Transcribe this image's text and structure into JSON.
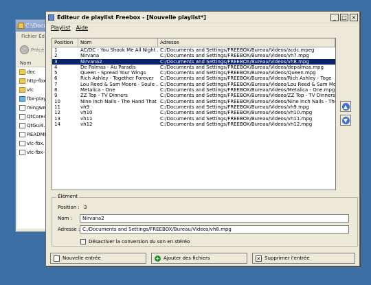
{
  "explorer": {
    "title": "C:\\Docu",
    "menu_file": "Fichier",
    "menu_edit": "Éd",
    "back_label": "Précé",
    "col_name": "Nom",
    "items": [
      {
        "name": "doc",
        "kind": "folder"
      },
      {
        "name": "http-fbx",
        "kind": "folder"
      },
      {
        "name": "vlc",
        "kind": "folder"
      },
      {
        "name": "fbx-play",
        "kind": "exe"
      },
      {
        "name": "mingwm",
        "kind": "file"
      },
      {
        "name": "QtCore4",
        "kind": "file"
      },
      {
        "name": "QtGui4.",
        "kind": "file"
      },
      {
        "name": "README",
        "kind": "file"
      },
      {
        "name": "vlc-fbx.",
        "kind": "file"
      },
      {
        "name": "vlc-fbx-",
        "kind": "file"
      }
    ]
  },
  "dialog": {
    "title": "Éditeur de playlist Freebox - [Nouvelle playlist*]",
    "menu": [
      "Playlist",
      "Aide"
    ],
    "columns": [
      "Position",
      "Nom",
      "Adresse"
    ],
    "rows": [
      {
        "pos": "1",
        "name": "AC/DC - You Shook Me All Night ...",
        "addr": "C:/Documents and Settings/FREEBOX/Bureau/Videos/acdc.mpeg"
      },
      {
        "pos": "2",
        "name": "Nirvana",
        "addr": "C:/Documents and Settings/FREEBOX/Bureau/Videos/vh7.mpg"
      },
      {
        "pos": "3",
        "name": "Nirvana2",
        "addr": "C:/Documents and Settings/FREEBOX/Bureau/Videos/vh8.mpg",
        "selected": true
      },
      {
        "pos": "4",
        "name": "De Palmas - Au Paradis",
        "addr": "C:/Documents and Settings/FREEBOX/Bureau/Videos/depalmas.mpg"
      },
      {
        "pos": "5",
        "name": "Queen - Spread Your Wings",
        "addr": "C:/Documents and Settings/FREEBOX/Bureau/Videos/Queen.mpg"
      },
      {
        "pos": "6",
        "name": "Rich Ashley - Together Forever",
        "addr": "C:/Documents and Settings/FREEBOX/Bureau/Videos/Rich Ashley - Toge"
      },
      {
        "pos": "7",
        "name": "Lou Reed & Sam Moore - Soule ...",
        "addr": "C:/Documents and Settings/FREEBOX/Bureau/Videos/Lou Reed & Sam Moore - "
      },
      {
        "pos": "8",
        "name": "Metalica - One",
        "addr": "C:/Documents and Settings/FREEBOX/Bureau/Videos/Metalica - One.mpg"
      },
      {
        "pos": "9",
        "name": "ZZ Top - TV Dinners",
        "addr": "C:/Documents and Settings/FREEBOX/Bureau/Videos/ZZ Top - TV Dinners.mp"
      },
      {
        "pos": "10",
        "name": "Nine Inch Nails - The Hand That ...",
        "addr": "C:/Documents and Settings/FREEBOX/Bureau/Videos/Nine Inch Nails - The H"
      },
      {
        "pos": "11",
        "name": "vh9",
        "addr": "C:/Documents and Settings/FREEBOX/Bureau/Videos/vh9.mpg"
      },
      {
        "pos": "12",
        "name": "vh10",
        "addr": "C:/Documents and Settings/FREEBOX/Bureau/Videos/vh10.mpg"
      },
      {
        "pos": "13",
        "name": "vh11",
        "addr": "C:/Documents and Settings/FREEBOX/Bureau/Videos/vh11.mpg"
      },
      {
        "pos": "14",
        "name": "vh12",
        "addr": "C:/Documents and Settings/FREEBOX/Bureau/Videos/vh12.mpg"
      }
    ],
    "element": {
      "legend": "Élément",
      "position_label": "Position :",
      "position_value": "3",
      "name_label": "Nom :",
      "name_value": "Nirvana2",
      "address_label": "Adresse :",
      "address_value": "C:/Documents and Settings/FREEBOX/Bureau/Videos/vh8.mpg",
      "checkbox_label": "Désactiver la conversion du son en stéréo"
    },
    "buttons": {
      "new": "Nouvelle entrée",
      "add": "Ajouter des fichiers",
      "delete": "Supprimer l'entrée"
    },
    "colors": {
      "selection": "#0a246a",
      "desktop": "#3a6ea5"
    }
  }
}
